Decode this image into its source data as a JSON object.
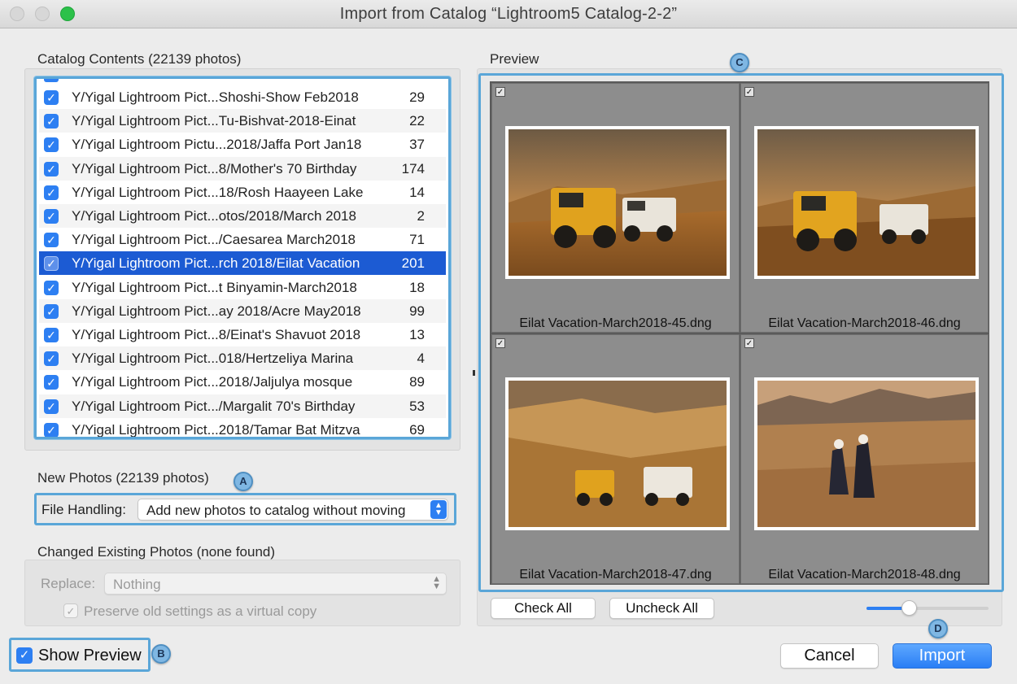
{
  "window": {
    "title": "Import from Catalog “Lightroom5 Catalog-2-2”"
  },
  "catalog": {
    "heading": "Catalog Contents (22139 photos)",
    "rows": [
      {
        "path": "Y/Yigal Lightroom Pict...Shoshi-Show Feb2018",
        "count": "29",
        "checked": true
      },
      {
        "path": "Y/Yigal Lightroom Pict...Tu-Bishvat-2018-Einat",
        "count": "22",
        "checked": true
      },
      {
        "path": "Y/Yigal Lightroom Pictu...2018/Jaffa Port Jan18",
        "count": "37",
        "checked": true
      },
      {
        "path": "Y/Yigal Lightroom Pict...8/Mother's 70 Birthday",
        "count": "174",
        "checked": true
      },
      {
        "path": "Y/Yigal Lightroom Pict...18/Rosh Haayeen Lake",
        "count": "14",
        "checked": true
      },
      {
        "path": "Y/Yigal Lightroom Pict...otos/2018/March 2018",
        "count": "2",
        "checked": true
      },
      {
        "path": "Y/Yigal Lightroom Pict.../Caesarea March2018",
        "count": "71",
        "checked": true
      },
      {
        "path": "Y/Yigal Lightroom Pict...rch 2018/Eilat Vacation",
        "count": "201",
        "checked": true,
        "selected": true
      },
      {
        "path": "Y/Yigal Lightroom Pict...t Binyamin-March2018",
        "count": "18",
        "checked": true
      },
      {
        "path": "Y/Yigal Lightroom Pict...ay 2018/Acre May2018",
        "count": "99",
        "checked": true
      },
      {
        "path": "Y/Yigal Lightroom Pict...8/Einat's Shavuot 2018",
        "count": "13",
        "checked": true
      },
      {
        "path": "Y/Yigal Lightroom Pict...018/Hertzeliya Marina",
        "count": "4",
        "checked": true
      },
      {
        "path": "Y/Yigal Lightroom Pict...2018/Jaljulya mosque",
        "count": "89",
        "checked": true
      },
      {
        "path": "Y/Yigal Lightroom Pict.../Margalit 70's Birthday",
        "count": "53",
        "checked": true
      },
      {
        "path": "Y/Yigal Lightroom Pict...2018/Tamar Bat Mitzva",
        "count": "69",
        "checked": true
      }
    ]
  },
  "new_photos": {
    "heading": "New Photos (22139 photos)",
    "file_handling_label": "File Handling:",
    "file_handling_value": "Add new photos to catalog without moving"
  },
  "changed": {
    "heading": "Changed Existing Photos (none found)",
    "replace_label": "Replace:",
    "replace_value": "Nothing",
    "preserve_label": "Preserve old settings as a virtual copy"
  },
  "show_preview": {
    "label": "Show Preview",
    "checked": true
  },
  "preview": {
    "heading": "Preview",
    "items": [
      {
        "name": "Eilat Vacation-March2018-45.dng",
        "checked": true
      },
      {
        "name": "Eilat Vacation-March2018-46.dng",
        "checked": true
      },
      {
        "name": "Eilat Vacation-March2018-47.dng",
        "checked": true
      },
      {
        "name": "Eilat Vacation-March2018-48.dng",
        "checked": true
      }
    ],
    "check_all": "Check All",
    "uncheck_all": "Uncheck All",
    "thumbnail_size": 0.35
  },
  "buttons": {
    "cancel": "Cancel",
    "import": "Import"
  },
  "badges": {
    "a": "A",
    "b": "B",
    "c": "C",
    "d": "D"
  },
  "colors": {
    "accent": "#2d7ff2",
    "selection": "#1c5bd3",
    "callout_outline": "#5aa6d8"
  },
  "glyphs": {
    "check": "✓",
    "checkmark_small": "✔"
  }
}
